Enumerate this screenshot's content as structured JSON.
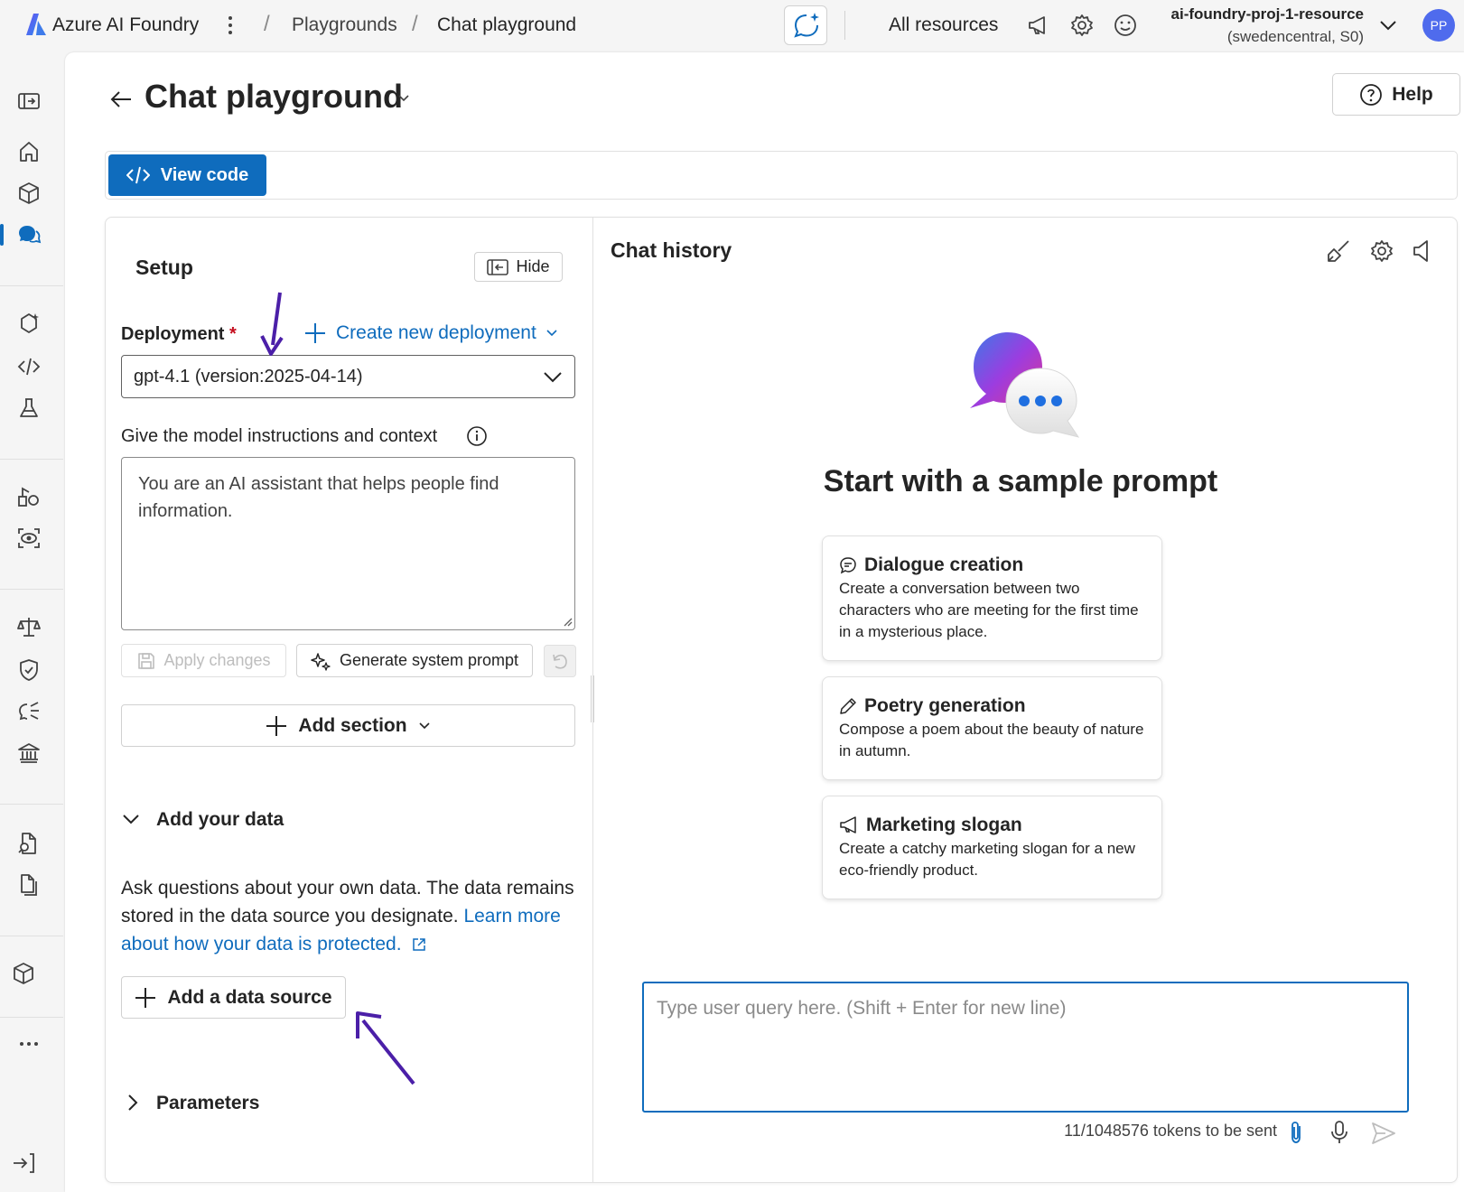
{
  "topbar": {
    "app_name": "Azure AI Foundry",
    "breadcrumb": [
      "Playgrounds",
      "Chat playground"
    ],
    "all_resources": "All resources",
    "resource_name": "ai-foundry-proj-1-resource",
    "resource_region": "(swedencentral, S0)",
    "avatar_initials": "PP"
  },
  "page": {
    "title": "Chat playground",
    "help_label": "Help",
    "view_code_label": "View code"
  },
  "setup": {
    "title": "Setup",
    "hide_label": "Hide",
    "deployment_label": "Deployment",
    "required_mark": "*",
    "create_deployment_label": "Create new deployment",
    "deployment_value": "gpt-4.1 (version:2025-04-14)",
    "instructions_label": "Give the model instructions and context",
    "instructions_value": "You are an AI assistant that helps people find information.",
    "apply_changes_label": "Apply changes",
    "generate_prompt_label": "Generate system prompt",
    "add_section_label": "Add section",
    "add_data_title": "Add your data",
    "add_data_desc": "Ask questions about your own data. The data remains stored in the data source you designate.",
    "learn_more_link": "Learn more about how your data is protected.",
    "add_data_source_label": "Add a data source",
    "parameters_title": "Parameters"
  },
  "chat": {
    "title": "Chat history",
    "heading": "Start with a sample prompt",
    "cards": [
      {
        "title": "Dialogue creation",
        "desc": "Create a conversation between two characters who are meeting for the first time in a mysterious place."
      },
      {
        "title": "Poetry generation",
        "desc": "Compose a poem about the beauty of nature in autumn."
      },
      {
        "title": "Marketing slogan",
        "desc": "Create a catchy marketing slogan for a new eco-friendly product."
      }
    ],
    "query_placeholder": "Type user query here. (Shift + Enter for new line)",
    "token_count": "11/1048576 tokens to be sent"
  },
  "colors": {
    "accent": "#0f6cbd",
    "annotation_arrow": "#4b1fa8",
    "avatar_bg": "#4f6bed"
  }
}
